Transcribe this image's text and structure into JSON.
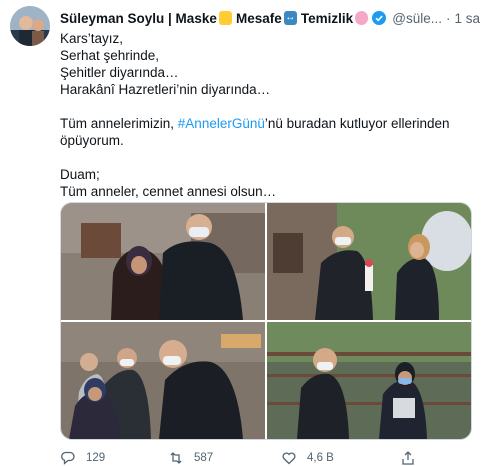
{
  "tweet": {
    "author_name": "Süleyman Soylu | Maske",
    "name_part2": "Mesafe",
    "name_part3": "Temizlik",
    "handle": "@süle...",
    "separator": "·",
    "time": "1 sa",
    "lines": [
      "Kars’tayız,",
      "Serhat şehrinde,",
      "Şehitler diyarında…",
      "Harakânî Hazretleri’nin diyarında…"
    ],
    "para2_before": "Tüm annelerimizin, ",
    "hashtag": "#AnnelerGünü",
    "para2_after": "’nü buradan kutluyor ellerinden öpüyorum.",
    "para3_line1": "Duam;",
    "para3_line2": "Tüm anneler, cennet annesi olsun…"
  },
  "actions": {
    "replies": "129",
    "retweets": "587",
    "likes": "4,6 B"
  },
  "colors": {
    "accent": "#1d9bf0",
    "muted": "#536471",
    "text": "#0f1419",
    "border": "#cfd9de"
  }
}
